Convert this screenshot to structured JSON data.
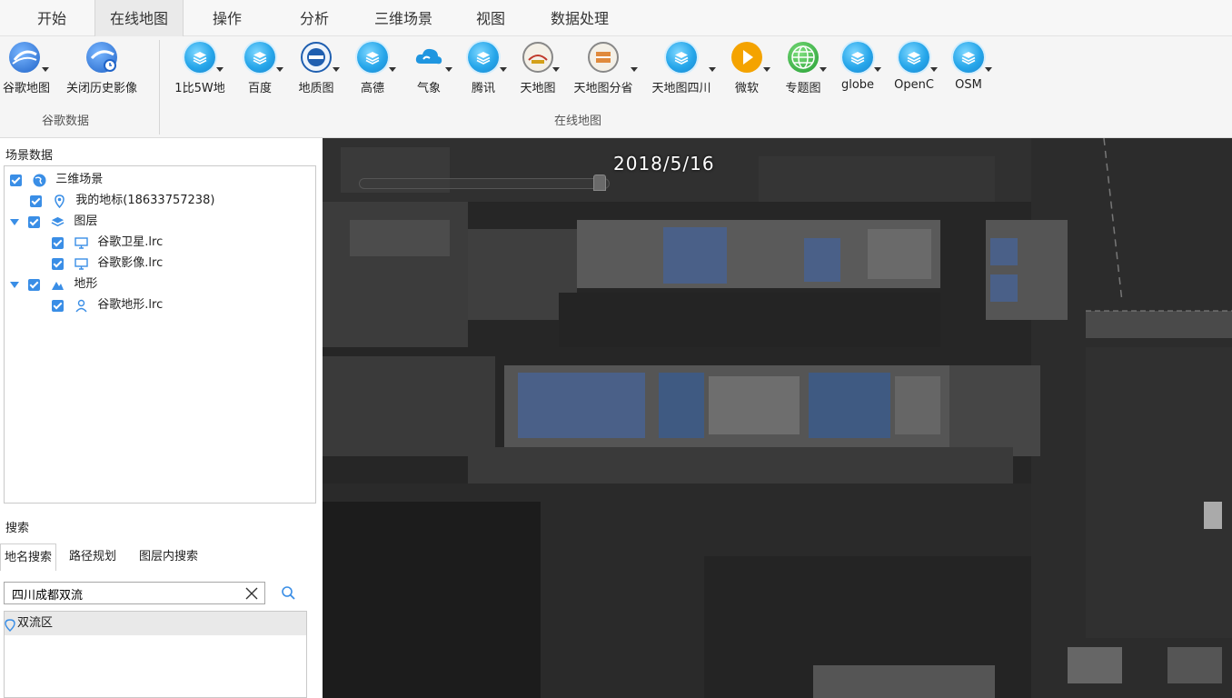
{
  "menu": {
    "tabs": [
      {
        "label": "开始"
      },
      {
        "label": "在线地图"
      },
      {
        "label": "操作"
      },
      {
        "label": "分析"
      },
      {
        "label": "三维场景"
      },
      {
        "label": "视图"
      },
      {
        "label": "数据处理"
      }
    ],
    "active_tab": "在线地图"
  },
  "ribbon": {
    "google_group": {
      "label": "谷歌数据",
      "buttons": [
        {
          "label": "谷歌地图",
          "icon": "google-earth-icon"
        },
        {
          "label": "关闭历史影像",
          "icon": "history-imagery-icon"
        }
      ]
    },
    "online_group": {
      "label": "在线地图",
      "buttons": [
        {
          "label": "1比5W地",
          "icon": "layers-icon"
        },
        {
          "label": "百度",
          "icon": "layers-icon"
        },
        {
          "label": "地质图",
          "icon": "geology-icon"
        },
        {
          "label": "高德",
          "icon": "layers-icon"
        },
        {
          "label": "气象",
          "icon": "cloud-icon"
        },
        {
          "label": "腾讯",
          "icon": "layers-icon"
        },
        {
          "label": "天地图",
          "icon": "tianditu-icon"
        },
        {
          "label": "天地图分省",
          "icon": "tianditu-province-icon"
        },
        {
          "label": "天地图四川",
          "icon": "layers-icon"
        },
        {
          "label": "微软",
          "icon": "bing-icon"
        },
        {
          "label": "专题图",
          "icon": "thematic-globe-icon"
        },
        {
          "label": "globe",
          "icon": "layers-icon"
        },
        {
          "label": "OpenC",
          "icon": "layers-icon"
        },
        {
          "label": "OSM",
          "icon": "layers-icon"
        }
      ]
    }
  },
  "scene_panel": {
    "title": "场景数据",
    "tree": [
      {
        "label": "三维场景",
        "icon": "globe-icon"
      },
      {
        "label": "我的地标(18633757238)",
        "icon": "pin-icon"
      },
      {
        "label": "图层",
        "icon": "layers-icon"
      },
      {
        "label": "谷歌卫星.lrc",
        "icon": "monitor-icon"
      },
      {
        "label": "谷歌影像.lrc",
        "icon": "monitor-icon"
      },
      {
        "label": "地形",
        "icon": "terrain-icon"
      },
      {
        "label": "谷歌地形.lrc",
        "icon": "person-pin-icon"
      }
    ]
  },
  "search_panel": {
    "title": "搜索",
    "tabs": [
      {
        "label": "地名搜索"
      },
      {
        "label": "路径规划"
      },
      {
        "label": "图层内搜索"
      }
    ],
    "query": "四川成都双流",
    "results": [
      {
        "label": "双流区"
      }
    ]
  },
  "map": {
    "date": "2018/5/16"
  },
  "colors": {
    "accent": "#3a8ee6",
    "icon_blue": "#26a6ea",
    "map_background": "#1a1a1a"
  }
}
